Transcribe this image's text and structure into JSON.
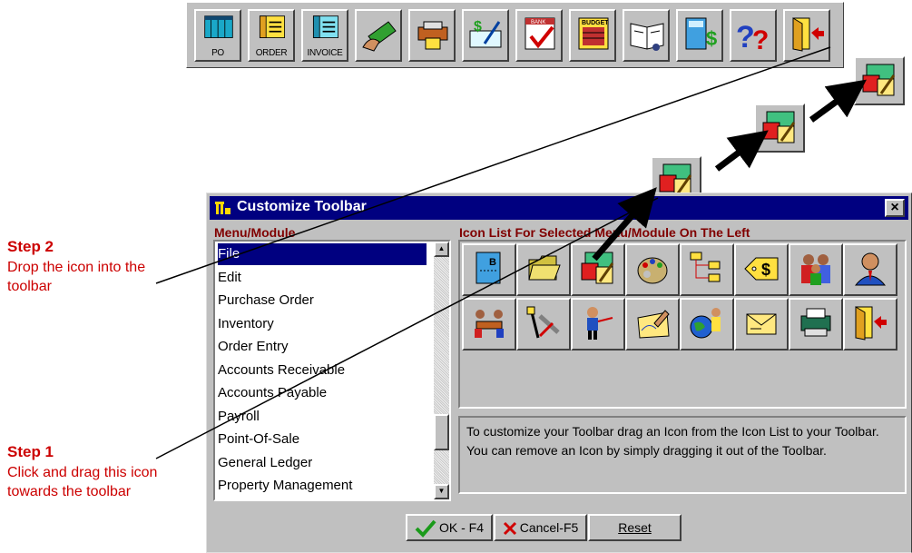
{
  "toolbar": {
    "buttons": [
      {
        "name": "po-icon",
        "caption": "PO"
      },
      {
        "name": "order-icon",
        "caption": "ORDER"
      },
      {
        "name": "invoice-icon",
        "caption": "INVOICE"
      },
      {
        "name": "money-hand-icon",
        "caption": ""
      },
      {
        "name": "register-icon",
        "caption": ""
      },
      {
        "name": "check-icon",
        "caption": ""
      },
      {
        "name": "bank-icon",
        "caption": ""
      },
      {
        "name": "budget-icon",
        "caption": ""
      },
      {
        "name": "book-icon",
        "caption": ""
      },
      {
        "name": "calculator-icon",
        "caption": ""
      },
      {
        "name": "help-icon",
        "caption": ""
      },
      {
        "name": "exit-door-icon",
        "caption": ""
      }
    ],
    "bank_label": "BANK",
    "budget_label": "BUDGET"
  },
  "dialog": {
    "title": "Customize Toolbar",
    "close_label": "×",
    "menu_heading": "Menu/Module",
    "icon_heading": "Icon List For Selected Menu/Module On The Left",
    "modules": [
      "File",
      "Edit",
      "Purchase Order",
      "Inventory",
      "Order Entry",
      "Accounts Receivable",
      "Accounts Payable",
      "Payroll",
      "Point-Of-Sale",
      "General Ledger",
      "Property Management"
    ],
    "selected_module": "File",
    "icon_palette": [
      "document-b-icon",
      "folder-open-icon",
      "edit-form-icon",
      "palette-icon",
      "org-chart-icon",
      "price-tag-icon",
      "people-group-icon",
      "person-icon",
      "meeting-icon",
      "tools-icon",
      "presenter-icon",
      "signing-icon",
      "world-icon",
      "mail-icon",
      "printer-icon",
      "exit-door-icon"
    ],
    "doc_b_letter": "B",
    "tag_symbol": "$",
    "hint": "To customize your Toolbar drag an Icon from the Icon List to your Toolbar.  You can remove an Icon by simply dragging it out of the Toolbar.",
    "buttons": {
      "ok": "OK - F4",
      "cancel": "Cancel-F5",
      "reset": "Reset"
    }
  },
  "annotations": {
    "step2_title": "Step 2",
    "step2_desc": "Drop the icon into the toolbar",
    "step1_title": "Step 1",
    "step1_desc": "Click and drag this icon towards the toolbar"
  },
  "colors": {
    "titlebar": "#000080",
    "heading": "#800000",
    "annotation": "#cc0000",
    "face": "#c0c0c0"
  }
}
